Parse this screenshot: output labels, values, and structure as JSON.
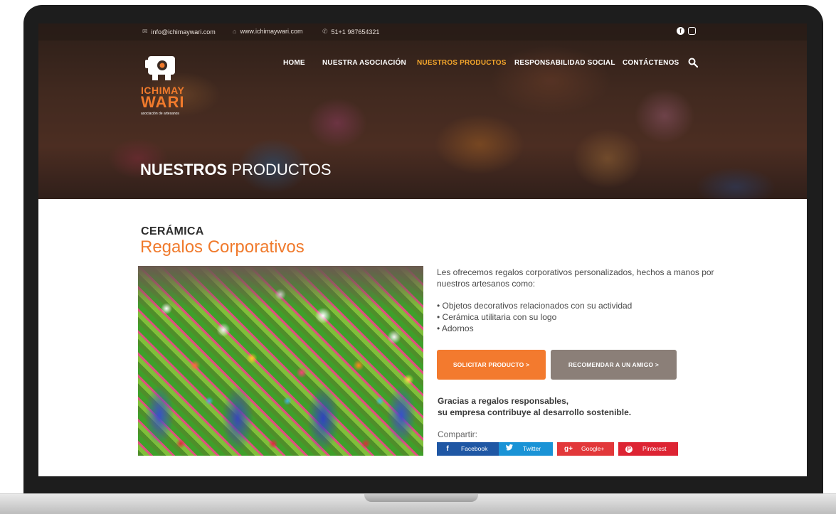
{
  "topbar": {
    "email": "info@ichimaywari.com",
    "website": "www.ichimaywari.com",
    "phone": "51+1 987654321",
    "email_icon": "mail-icon",
    "website_icon": "home-icon",
    "phone_icon": "phone-icon",
    "social": [
      "facebook-icon",
      "instagram-icon"
    ]
  },
  "logo": {
    "line1": "ICHIMAY",
    "line2": "WARI",
    "subtitle": "asociación de artesanos"
  },
  "nav": {
    "items": [
      {
        "label": "HOME",
        "active": false
      },
      {
        "label": "NUESTRA ASOCIACIÓN",
        "active": false
      },
      {
        "label": "NUESTROS PRODUCTOS",
        "active": true
      },
      {
        "label": "RESPONSABILIDAD SOCIAL",
        "active": false
      },
      {
        "label": "CONTÁCTENOS",
        "active": false
      }
    ],
    "search_icon": "search-icon"
  },
  "hero": {
    "title_bold": "NUESTROS",
    "title_regular": "PRODUCTOS"
  },
  "product": {
    "category": "CERÁMICA",
    "title": "Regalos Corporativos",
    "description": "Les ofrecemos regalos corporativos personalizados, hechos a manos por nuestros artesanos como:",
    "bullets": [
      "• Objetos decorativos relacionados con su actividad",
      "• Cerámica utilitaria con su logo",
      "• Adornos"
    ],
    "primary_button": "SOLICITAR PRODUCTO >",
    "secondary_button": "RECOMENDAR A UN AMIGO >",
    "tagline_line1": "Gracias a regalos responsables,",
    "tagline_line2": "su empresa contribuye al desarrollo sostenible."
  },
  "share": {
    "label": "Compartir:",
    "buttons": [
      {
        "label": "Facebook",
        "icon": "f"
      },
      {
        "label": "Twitter",
        "icon": "✓"
      },
      {
        "label": "Google+",
        "icon": "g+"
      },
      {
        "label": "Pinterest",
        "icon": "P"
      }
    ]
  },
  "colors": {
    "accent": "#f37a2e",
    "nav_active": "#f3a52b",
    "secondary_button": "#8b7f78",
    "facebook": "#1f57a4",
    "twitter": "#1a93d6",
    "googleplus": "#e2383a",
    "pinterest": "#dd2433"
  }
}
